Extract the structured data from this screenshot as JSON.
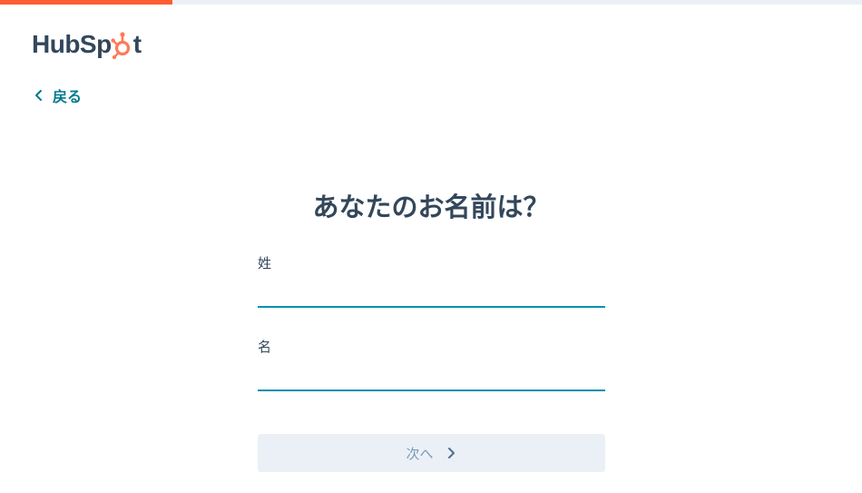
{
  "progress": {
    "fraction": 0.2,
    "fill_color": "#ff5c35",
    "track_color": "#eaf0f6"
  },
  "logo": {
    "text_left": "HubSp",
    "text_right": "t",
    "icon": "sprocket-icon",
    "accent": "#ff7a59"
  },
  "back": {
    "label": "戻る",
    "icon": "chevron-left-icon"
  },
  "title": "あなたのお名前は？",
  "fields": {
    "last_name": {
      "label": "姓",
      "value": ""
    },
    "first_name": {
      "label": "名",
      "value": ""
    }
  },
  "next_button": {
    "label": "次へ",
    "icon": "chevron-right-icon"
  },
  "colors": {
    "text": "#33475b",
    "link": "#0091ae",
    "input_underline": "#0091ae",
    "button_bg": "#eaf0f6",
    "button_text": "#7c98b6"
  }
}
